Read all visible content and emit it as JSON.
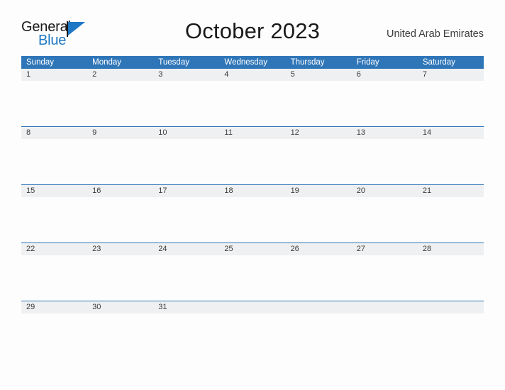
{
  "brand": {
    "name_part1": "General",
    "name_part2": "Blue",
    "flag_icon": "blue-flag-triangle"
  },
  "header": {
    "title": "October 2023",
    "region": "United Arab Emirates"
  },
  "colors": {
    "header_blue": "#2f76b8",
    "row_band_gray": "#eff0f1",
    "brand_blue": "#1d77c4",
    "page_background": "#fdfdfd",
    "text_dark": "#1a1a1a"
  },
  "calendar": {
    "month": "October",
    "year": "2023",
    "weekday_headers": [
      "Sunday",
      "Monday",
      "Tuesday",
      "Wednesday",
      "Thursday",
      "Friday",
      "Saturday"
    ],
    "weeks": [
      [
        "1",
        "2",
        "3",
        "4",
        "5",
        "6",
        "7"
      ],
      [
        "8",
        "9",
        "10",
        "11",
        "12",
        "13",
        "14"
      ],
      [
        "15",
        "16",
        "17",
        "18",
        "19",
        "20",
        "21"
      ],
      [
        "22",
        "23",
        "24",
        "25",
        "26",
        "27",
        "28"
      ],
      [
        "29",
        "30",
        "31",
        "",
        "",
        "",
        ""
      ]
    ]
  }
}
